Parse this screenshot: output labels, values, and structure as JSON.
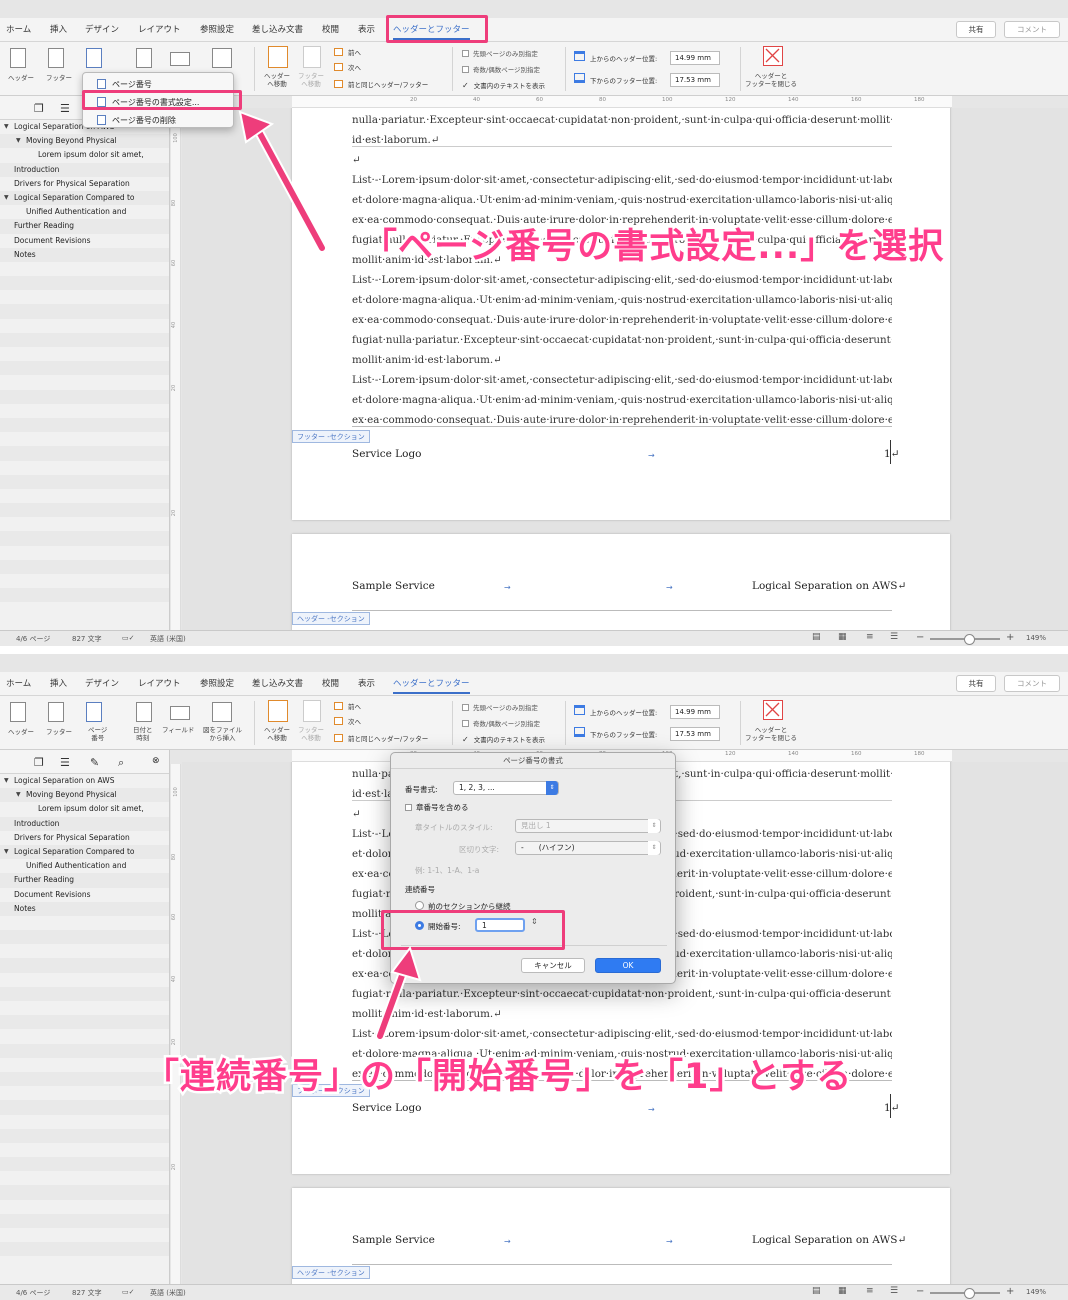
{
  "menu": [
    "ホーム",
    "挿入",
    "デザイン",
    "レイアウト",
    "参照設定",
    "差し込み文書",
    "校閲",
    "表示",
    "ヘッダーとフッター"
  ],
  "share_label": "共有",
  "comment_label": "コメント",
  "ribbon": {
    "header": "ヘッダー",
    "footer": "フッター",
    "page_number": "ページ\n番号",
    "date_time": "日付と\n時刻",
    "field": "フィールド",
    "from_file": "図をファイル\nから挿入",
    "to_header": "ヘッダー\nへ移動",
    "to_footer": "フッター\nへ移動",
    "prev": "前へ",
    "next": "次へ",
    "link_prev": "前と同じヘッダー/フッター",
    "first_page": "先頭ページのみ別指定",
    "odd_even": "奇数/偶数ページ別指定",
    "show_text": "文書内のテキストを表示",
    "header_pos_label": "上からのヘッダー位置:",
    "header_pos_value": "14.99 mm",
    "footer_pos_label": "下からのフッター位置:",
    "footer_pos_value": "17.53 mm",
    "close": "ヘッダーと\nフッターを閉じる"
  },
  "page_number_menu": [
    "ページ番号",
    "ページ番号の書式設定...",
    "ページ番号の削除"
  ],
  "outline": [
    {
      "level": 0,
      "text": "Logical Separation on AWS",
      "expanded": true
    },
    {
      "level": 1,
      "text": "Moving Beyond Physical",
      "expanded": true
    },
    {
      "level": 2,
      "text": "Lorem ipsum dolor sit amet,"
    },
    {
      "level": 0,
      "text": "Introduction"
    },
    {
      "level": 0,
      "text": "Drivers for Physical Separation"
    },
    {
      "level": 0,
      "text": "Logical Separation Compared to",
      "expanded": true
    },
    {
      "level": 1,
      "text": "Unified Authentication and"
    },
    {
      "level": 0,
      "text": "Further Reading"
    },
    {
      "level": 0,
      "text": "Document Revisions"
    },
    {
      "level": 0,
      "text": "Notes"
    }
  ],
  "ruler_h": [
    "20",
    "40",
    "60",
    "80",
    "100",
    "120",
    "140",
    "160",
    "180"
  ],
  "ruler_v": [
    "100",
    "80",
    "60",
    "40",
    "20",
    "20"
  ],
  "document": {
    "lines_top": [
      "nulla·pariatur.·Excepteur·sint·occaecat·cupidatat·non·proident,·sunt·in·culpa·qui·officia·deserunt·mollit·anim·",
      "id·est·laborum.↵",
      "↵"
    ],
    "lines": [
      "List·-·Lorem·ipsum·dolor·sit·amet,·consectetur·adipiscing·elit,·sed·do·eiusmod·tempor·incididunt·ut·labore·",
      "et·dolore·magna·aliqua.·Ut·enim·ad·minim·veniam,·quis·nostrud·exercitation·ullamco·laboris·nisi·ut·aliquip·",
      "ex·ea·commodo·consequat.·Duis·aute·irure·dolor·in·reprehenderit·in·voluptate·velit·esse·cillum·dolore·eu·",
      "fugiat·nulla·pariatur.·Excepteur·sint·occaecat·cupidatat·non·proident,·sunt·in·culpa·qui·officia·deserunt·",
      "mollit·anim·id·est·laborum.↵",
      "List·-·Lorem·ipsum·dolor·sit·amet,·consectetur·adipiscing·elit,·sed·do·eiusmod·tempor·incididunt·ut·labore·",
      "et·dolore·magna·aliqua.·Ut·enim·ad·minim·veniam,·quis·nostrud·exercitation·ullamco·laboris·nisi·ut·aliquip·",
      "ex·ea·commodo·consequat.·Duis·aute·irure·dolor·in·reprehenderit·in·voluptate·velit·esse·cillum·dolore·eu·",
      "fugiat·nulla·pariatur.·Excepteur·sint·occaecat·cupidatat·non·proident,·sunt·in·culpa·qui·officia·deserunt·",
      "mollit·anim·id·est·laborum.↵",
      "List·-·Lorem·ipsum·dolor·sit·amet,·consectetur·adipiscing·elit,·sed·do·eiusmod·tempor·incididunt·ut·labore·",
      "et·dolore·magna·aliqua.·Ut·enim·ad·minim·veniam,·quis·nostrud·exercitation·ullamco·laboris·nisi·ut·aliquip·",
      "ex·ea·commodo·consequat.·Duis·aute·irure·dolor·in·reprehenderit·in·voluptate·velit·esse·cillum·dolore·eu·"
    ],
    "footer_tag": "フッター -セクション",
    "footer_left": "Service Logo",
    "footer_page": "1↵",
    "header_tag": "ヘッダー -セクション",
    "header_left": "Sample Service",
    "header_right": "Logical Separation on AWS↵",
    "tab_arrow": "→"
  },
  "status": {
    "page": "4/6 ページ",
    "words": "827 文字",
    "lang": "英語 (米国)",
    "zoom": "149%"
  },
  "dialog": {
    "title": "ページ番号の書式",
    "format_label": "番号書式:",
    "format_value": "1, 2, 3, ...",
    "include_chapter": "章番号を含める",
    "chapter_style_label": "章タイトルのスタイル:",
    "chapter_style_value": "見出し 1",
    "separator_label": "区切り文字:",
    "separator_value": "-　　(ハイフン)",
    "example": "例:  1-1、1-A、1-a",
    "numbering_label": "連続番号",
    "continue_label": "前のセクションから継続",
    "start_at_label": "開始番号:",
    "start_at_value": "1",
    "cancel": "キャンセル",
    "ok": "OK"
  },
  "annotations": {
    "step1": "「ページ番号の書式設定...」を選択",
    "step2": "「連続番号」の「開始番号」を「1」とする"
  },
  "colors": {
    "accent": "#ee3d7b",
    "callout": "#ff3d8c",
    "blue": "#3d7be3"
  }
}
